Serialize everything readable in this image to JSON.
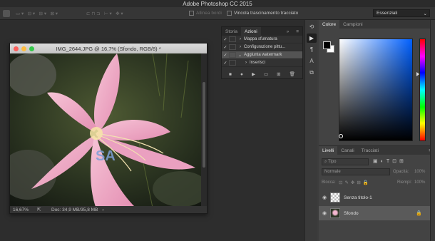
{
  "app": {
    "title": "Adobe Photoshop CC 2015"
  },
  "options_bar": {
    "align_edges_label": "Allinea bordi",
    "constrain_path_label": "Vincola trascinamento tracciato",
    "workspace": "Essenziali"
  },
  "document": {
    "title": "IMG_2644.JPG @ 16,7% (Sfondo, RGB/8) *",
    "zoom": "16,67%",
    "doc_info": "Doc: 34,9 MB/35,8 MB",
    "watermark_text": "SA",
    "traffic_colors": [
      "#fc605c",
      "#fdbc40",
      "#34c84a"
    ]
  },
  "actions_panel": {
    "tabs": [
      "Storia",
      "Azioni"
    ],
    "active_tab": "Azioni",
    "rows": [
      {
        "label": "Mappa sfumatura",
        "checked": true,
        "indent": 1,
        "arrow": "›"
      },
      {
        "label": "Configurazione pittu...",
        "checked": true,
        "indent": 1,
        "arrow": "›"
      },
      {
        "label": "Aggiunta watermark",
        "checked": true,
        "indent": 1,
        "arrow": "⌄",
        "selected": true
      },
      {
        "label": "Inserisci",
        "checked": true,
        "indent": 2,
        "arrow": "›"
      }
    ]
  },
  "color_panel": {
    "tabs": [
      "Colore",
      "Campioni"
    ],
    "active_tab": "Colore",
    "foreground": "#000000",
    "background": "#ffffff",
    "hue_color": "#0060ff"
  },
  "layers_panel": {
    "tabs": [
      "Livelli",
      "Canali",
      "Tracciati"
    ],
    "active_tab": "Livelli",
    "filter_label": "Tipo",
    "blend_mode": "Normale",
    "opacity_label": "Opacità:",
    "opacity_value": "100%",
    "lock_label": "Blocca:",
    "fill_label": "Riempi:",
    "fill_value": "100%",
    "layers": [
      {
        "name": "Senza titolo-1",
        "selected": false
      },
      {
        "name": "Sfondo",
        "selected": true,
        "locked": true
      }
    ]
  }
}
